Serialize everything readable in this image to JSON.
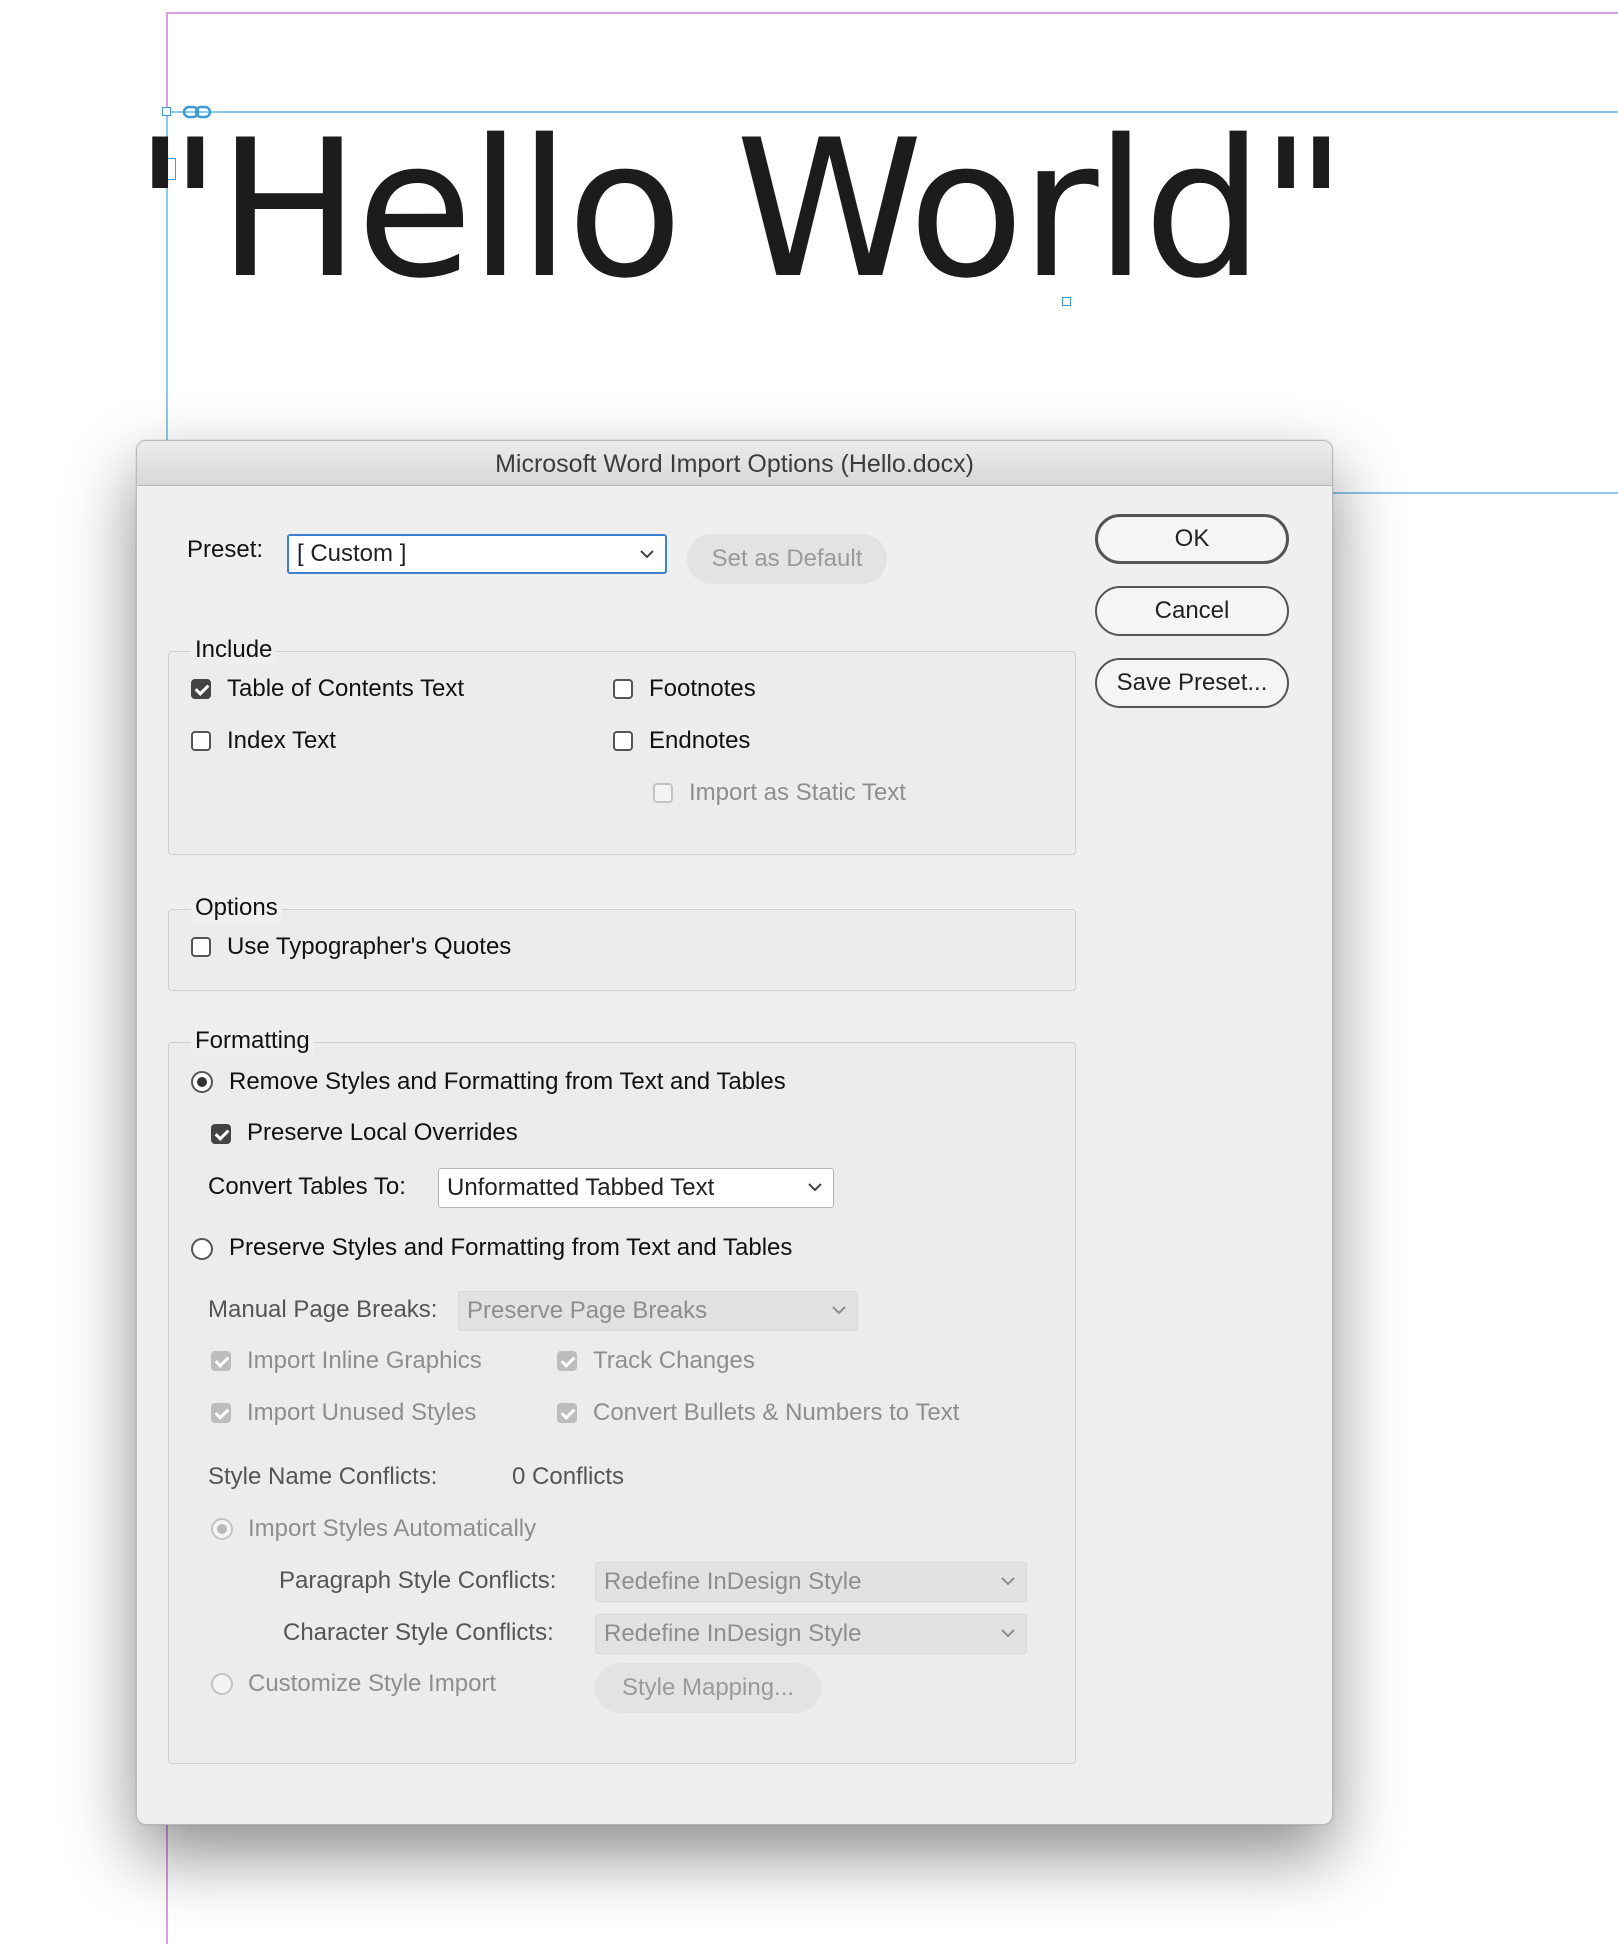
{
  "document": {
    "text": "\"Hello World\""
  },
  "dialog": {
    "title": "Microsoft Word Import Options (Hello.docx)",
    "preset": {
      "label": "Preset:",
      "value": "[ Custom ]",
      "set_default": "Set as Default"
    },
    "buttons": {
      "ok": "OK",
      "cancel": "Cancel",
      "save_preset": "Save Preset..."
    },
    "include": {
      "title": "Include",
      "toc_text": {
        "label": "Table of Contents Text",
        "checked": true
      },
      "index_text": {
        "label": "Index Text",
        "checked": false
      },
      "footnotes": {
        "label": "Footnotes",
        "checked": false
      },
      "endnotes": {
        "label": "Endnotes",
        "checked": false
      },
      "import_static": {
        "label": "Import as Static Text",
        "checked": false,
        "enabled": false
      }
    },
    "options": {
      "title": "Options",
      "typographers_quotes": {
        "label": "Use Typographer's Quotes",
        "checked": false
      }
    },
    "formatting": {
      "title": "Formatting",
      "remove_styles": {
        "label": "Remove Styles and Formatting from Text and Tables",
        "selected": true
      },
      "preserve_local": {
        "label": "Preserve Local Overrides",
        "checked": true
      },
      "convert_tables": {
        "label": "Convert Tables To:",
        "value": "Unformatted Tabbed Text"
      },
      "preserve_styles": {
        "label": "Preserve Styles and Formatting from Text and Tables",
        "selected": false
      },
      "manual_breaks": {
        "label": "Manual Page Breaks:",
        "value": "Preserve Page Breaks"
      },
      "inline_graphics": {
        "label": "Import Inline Graphics",
        "checked": true
      },
      "track_changes": {
        "label": "Track Changes",
        "checked": true
      },
      "unused_styles": {
        "label": "Import Unused Styles",
        "checked": true
      },
      "convert_bullets": {
        "label": "Convert Bullets & Numbers to Text",
        "checked": true
      },
      "style_conflicts": {
        "label": "Style Name Conflicts:",
        "value": "0 Conflicts"
      },
      "import_auto": {
        "label": "Import Styles Automatically",
        "selected": true
      },
      "para_conflicts": {
        "label": "Paragraph Style Conflicts:",
        "value": "Redefine InDesign Style"
      },
      "char_conflicts": {
        "label": "Character Style Conflicts:",
        "value": "Redefine InDesign Style"
      },
      "customize": {
        "label": "Customize Style Import",
        "selected": false
      },
      "style_mapping": "Style Mapping..."
    }
  },
  "colors": {
    "guide_magenta": "#d49ee0",
    "guide_blue": "#8cc8ea",
    "focus_blue": "#3f80d1",
    "dialog_bg": "#efefef"
  }
}
